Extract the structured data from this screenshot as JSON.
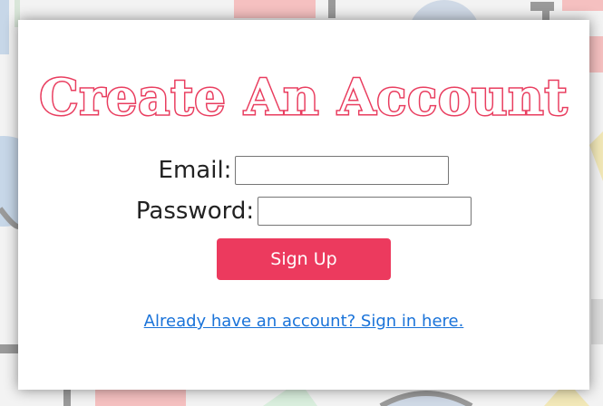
{
  "page": {
    "title": "Create An Account"
  },
  "form": {
    "email_label": "Email:",
    "email_value": "",
    "password_label": "Password:",
    "password_value": "",
    "submit_label": "Sign Up"
  },
  "footer": {
    "signin_link": "Already have an account? Sign in here."
  },
  "colors": {
    "accent": "#ec3a5e",
    "link": "#1a73d9",
    "background": "#f3f3f3",
    "card": "#ffffff"
  }
}
